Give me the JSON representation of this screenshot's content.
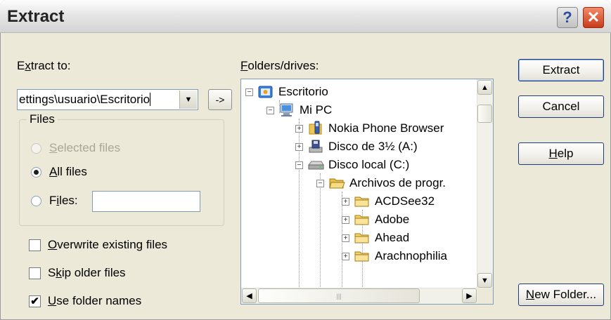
{
  "dialog": {
    "title": "Extract",
    "help_glyph": "?",
    "close_glyph": "✕"
  },
  "extract_to": {
    "label_pre": "E",
    "label_u": "x",
    "label_post": "tract to:",
    "value": "ettings\\usuario\\Escritorio",
    "go_label": "->"
  },
  "files_group": {
    "title": "Files",
    "options": [
      {
        "u": "S",
        "rest": "elected files",
        "pre": "",
        "checked": false,
        "disabled": true
      },
      {
        "u": "A",
        "rest": "ll files",
        "pre": "",
        "checked": true,
        "disabled": false
      },
      {
        "u": "i",
        "rest": "les:",
        "pre": "F",
        "checked": false,
        "disabled": false
      }
    ],
    "files_value": ""
  },
  "options": [
    {
      "pre": "",
      "u": "O",
      "rest": "verwrite existing files",
      "checked": false
    },
    {
      "pre": "S",
      "u": "k",
      "rest": "ip older files",
      "checked": false
    },
    {
      "pre": "",
      "u": "U",
      "rest": "se folder names",
      "checked": true
    }
  ],
  "folders": {
    "label_u": "F",
    "label_rest": "olders/drives:",
    "items": [
      {
        "label": "Escritorio",
        "icon": "desktop-icon",
        "expander": "−"
      },
      {
        "label": "Mi PC",
        "icon": "my-computer-icon",
        "expander": "−"
      },
      {
        "label": "Nokia Phone Browser",
        "icon": "phone-browser-icon",
        "expander": "+"
      },
      {
        "label": "Disco de 3½ (A:)",
        "icon": "floppy-drive-icon",
        "expander": "+"
      },
      {
        "label": "Disco local (C:)",
        "icon": "hard-drive-icon",
        "expander": "−"
      },
      {
        "label": "Archivos de progr.",
        "icon": "folder-open-icon",
        "expander": "−"
      },
      {
        "label": "ACDSee32",
        "icon": "folder-icon",
        "expander": "+"
      },
      {
        "label": "Adobe",
        "icon": "folder-icon",
        "expander": "+"
      },
      {
        "label": "Ahead",
        "icon": "folder-icon",
        "expander": "+"
      },
      {
        "label": "Arachnophilia",
        "icon": "folder-icon",
        "expander": "+"
      }
    ]
  },
  "buttons": {
    "extract": "Extract",
    "cancel": "Cancel",
    "help_u": "H",
    "help_rest": "elp",
    "new_folder_u": "N",
    "new_folder_rest": "ew Folder..."
  },
  "colors": {
    "dialog_bg": "#ece9d8",
    "field_border": "#7f9db9",
    "button_border": "#1f3a7a",
    "close_red": "#c93b1a",
    "folder_yellow": "#f5d36a"
  }
}
